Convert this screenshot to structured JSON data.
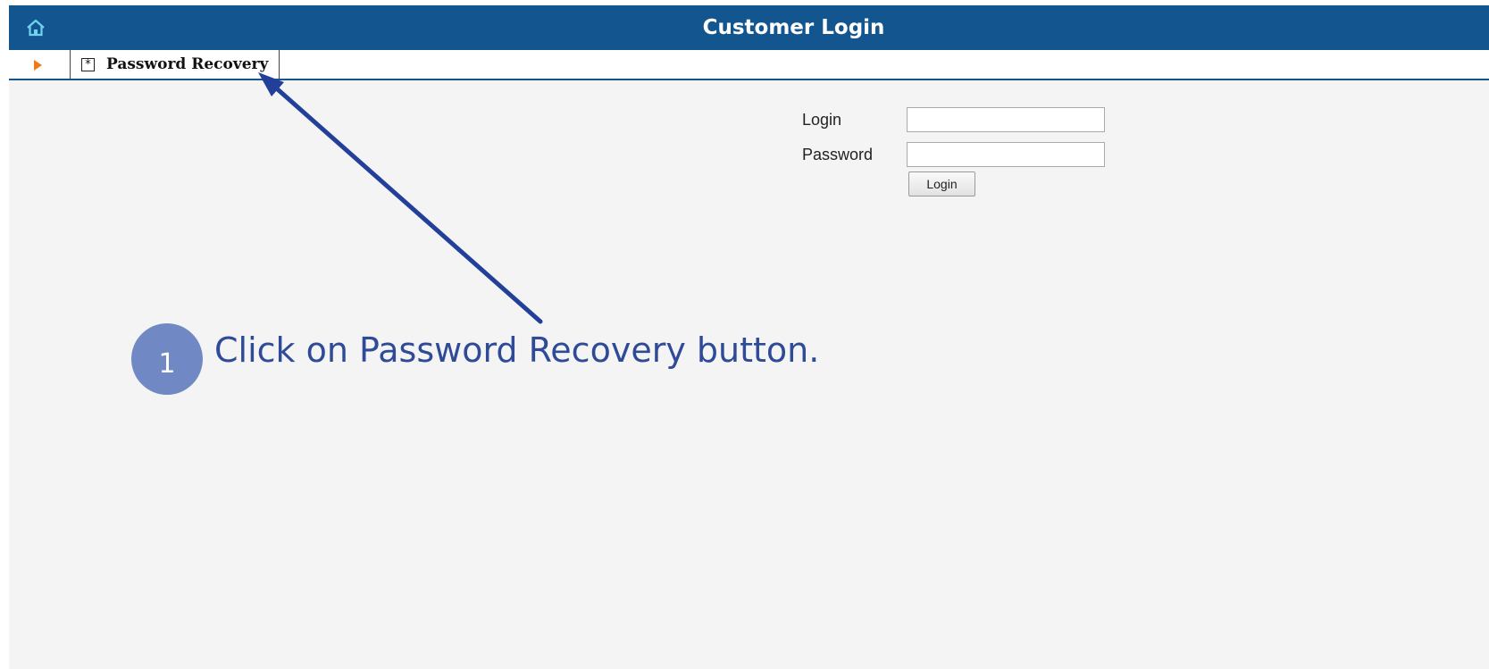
{
  "header": {
    "title": "Customer Login",
    "home_icon": "home-icon",
    "background_color": "#13558f"
  },
  "toolbar": {
    "toggle_icon": "triangle-right-icon",
    "password_recovery_icon": "asterisk-box-icon",
    "password_recovery_glyph": "*",
    "password_recovery_label": "Password Recovery"
  },
  "login_form": {
    "login_label": "Login",
    "login_value": "",
    "password_label": "Password",
    "password_value": "",
    "submit_label": "Login"
  },
  "annotation": {
    "step_number": "1",
    "step_text": "Click on Password Recovery button.",
    "color": "#2f4a97",
    "circle_color": "#7088c4"
  }
}
